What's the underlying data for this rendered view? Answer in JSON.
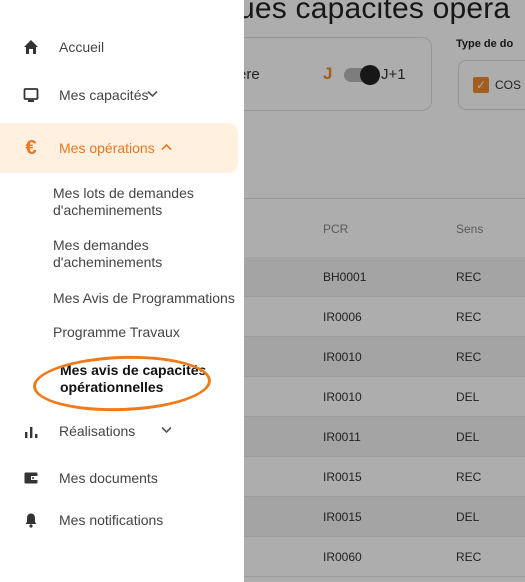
{
  "background": {
    "title": "ues capacites opera",
    "card_text": "ère",
    "toggle_left": "J",
    "toggle_right": "J+1",
    "type_label": "Type de do",
    "type_option": "COS",
    "table": {
      "headers": [
        "PCR",
        "Sens"
      ],
      "rows": [
        {
          "pcr": "BH0001",
          "sens": "REC"
        },
        {
          "pcr": "IR0006",
          "sens": "REC"
        },
        {
          "pcr": "IR0010",
          "sens": "REC"
        },
        {
          "pcr": "IR0010",
          "sens": "DEL"
        },
        {
          "pcr": "IR0011",
          "sens": "DEL"
        },
        {
          "pcr": "IR0015",
          "sens": "REC"
        },
        {
          "pcr": "IR0015",
          "sens": "DEL"
        },
        {
          "pcr": "IR0060",
          "sens": "REC"
        }
      ]
    }
  },
  "nav": {
    "accueil": {
      "label": "Accueil",
      "icon": "home-icon"
    },
    "capacites": {
      "label": "Mes capacités",
      "icon": "monitor-icon"
    },
    "operations": {
      "label": "Mes opérations",
      "icon": "euro-icon"
    },
    "sub": [
      {
        "label": "Mes lots de demandes d'acheminements"
      },
      {
        "label": "Mes demandes d'acheminements"
      },
      {
        "label": "Mes Avis de Programmations"
      },
      {
        "label": "Programme Travaux"
      },
      {
        "label": "Mes avis de capacités opérationnelles"
      }
    ],
    "realisations": {
      "label": "Réalisations",
      "icon": "bar-chart-icon"
    },
    "documents": {
      "label": "Mes documents",
      "icon": "wallet-icon"
    },
    "notifications": {
      "label": "Mes notifications",
      "icon": "bell-icon"
    }
  },
  "colors": {
    "accent": "#e87722",
    "active_bg": "#fff0e0",
    "highlight_circle": "#f07a1a"
  }
}
